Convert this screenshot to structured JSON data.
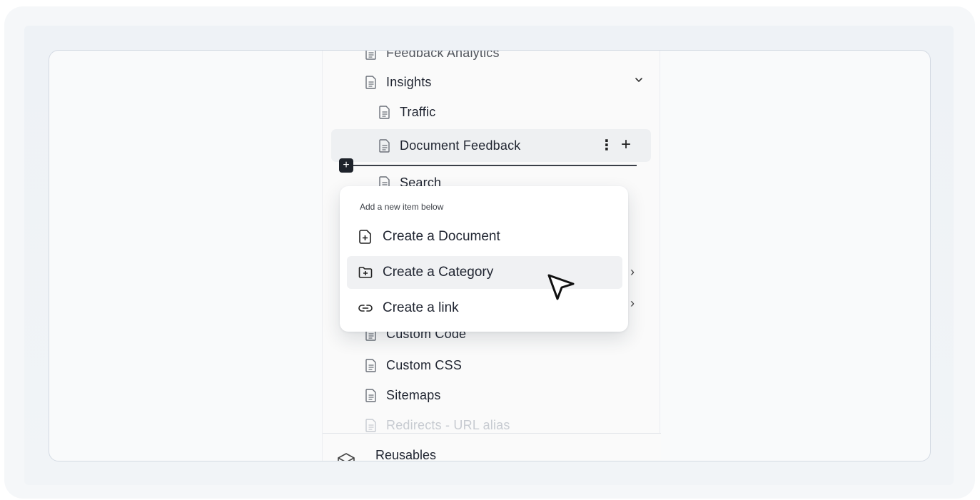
{
  "sidebar": {
    "cut_top_label": "Feedback Analytics",
    "items": [
      {
        "label": "Insights",
        "icon": "document-icon"
      },
      {
        "label": "Traffic",
        "icon": "document-icon"
      },
      {
        "label": "Document Feedback",
        "icon": "document-icon",
        "active": true
      },
      {
        "label": "Search",
        "icon": "document-icon"
      },
      {
        "label": "Custom Code",
        "icon": "document-icon"
      },
      {
        "label": "Custom CSS",
        "icon": "document-icon"
      },
      {
        "label": "Sitemaps",
        "icon": "document-icon"
      },
      {
        "label": "Redirects - URL alias",
        "icon": "document-icon"
      }
    ],
    "row_actions": {
      "more": "⋮",
      "add": "+"
    },
    "drop_indicator_plus": "+",
    "row_arrow": "›",
    "footer": {
      "label": "Reusables",
      "icon": "box-icon",
      "ext": "↗"
    }
  },
  "popup": {
    "heading": "Add a new item below",
    "items": [
      {
        "label": "Create a Document",
        "icon": "add-document-icon"
      },
      {
        "label": "Create a Category",
        "icon": "add-folder-icon",
        "hovered": true
      },
      {
        "label": "Create a link",
        "icon": "link-icon"
      }
    ]
  },
  "colors": {
    "active_row": "#eef0f2",
    "hover_item": "#f0f1f3",
    "drop_line": "#3a3f48"
  }
}
